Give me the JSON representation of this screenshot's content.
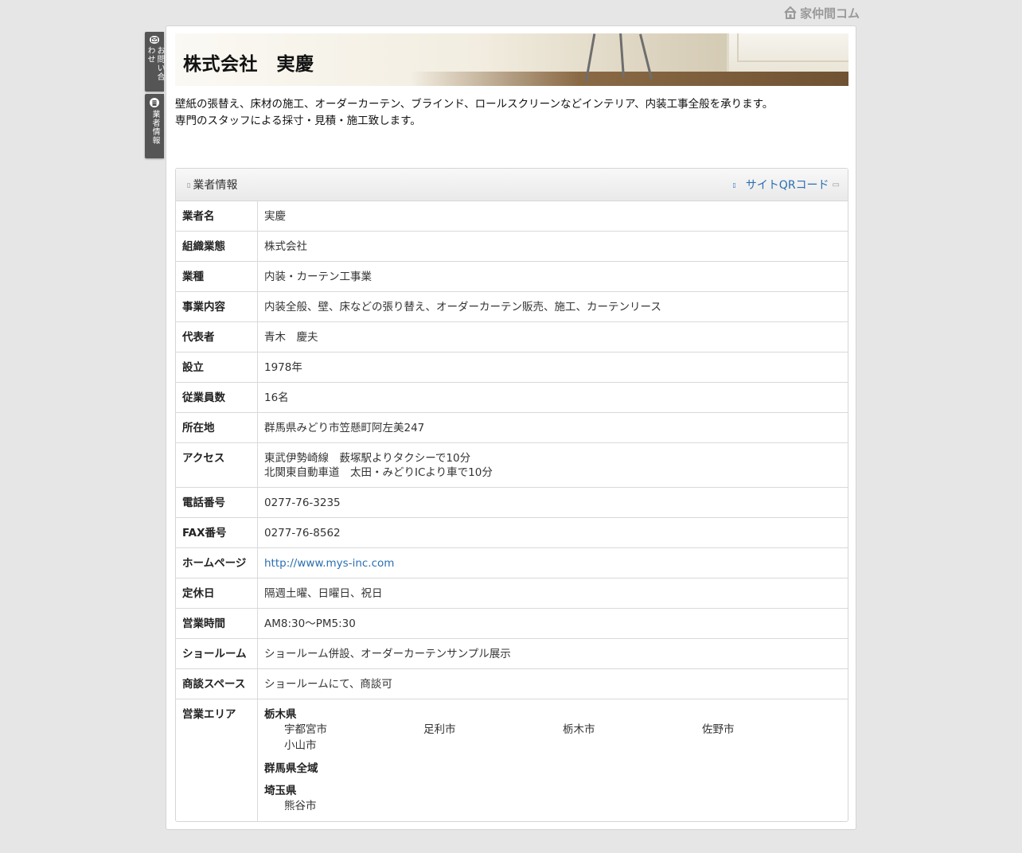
{
  "brand": {
    "name": "家仲間コム"
  },
  "side_tabs": {
    "contact": "お問い合わせ",
    "info": "業者情報"
  },
  "header": {
    "title": "株式会社　実慶"
  },
  "intro": {
    "line1": "壁紙の張替え、床材の施工、オーダーカーテン、ブラインド、ロールスクリーンなどインテリア、内装工事全般を承ります。",
    "line2": "専門のスタッフによる採寸・見積・施工致します。"
  },
  "panel": {
    "title": "業者情報",
    "qr_label": "サイトQRコード"
  },
  "rows": [
    {
      "label": "業者名",
      "value": "実慶"
    },
    {
      "label": "組織業態",
      "value": "株式会社"
    },
    {
      "label": "業種",
      "value": "内装・カーテン工事業"
    },
    {
      "label": "事業内容",
      "value": "内装全般、壁、床などの張り替え、オーダーカーテン販売、施工、カーテンリース"
    },
    {
      "label": "代表者",
      "value": "青木　慶夫"
    },
    {
      "label": "設立",
      "value": "1978年"
    },
    {
      "label": "従業員数",
      "value": "16名"
    },
    {
      "label": "所在地",
      "value": "群馬県みどり市笠懸町阿左美247"
    },
    {
      "label": "アクセス",
      "value": "東武伊勢崎線　薮塚駅よりタクシーで10分",
      "value2": "北関東自動車道　太田・みどりICより車で10分"
    },
    {
      "label": "電話番号",
      "value": "0277-76-3235"
    },
    {
      "label": "FAX番号",
      "value": "0277-76-8562"
    },
    {
      "label": "ホームページ",
      "value": "http://www.mys-inc.com"
    },
    {
      "label": "定休日",
      "value": "隔週土曜、日曜日、祝日"
    },
    {
      "label": "営業時間",
      "value": "AM8:30〜PM5:30"
    },
    {
      "label": "ショールーム",
      "value": "ショールーム併設、オーダーカーテンサンプル展示"
    },
    {
      "label": "商談スペース",
      "value": "ショールームにて、商談可"
    },
    {
      "label": "営業エリア"
    }
  ],
  "areas": [
    {
      "pref": "栃木県",
      "cities": [
        "宇都宮市",
        "足利市",
        "栃木市",
        "佐野市",
        "小山市"
      ]
    },
    {
      "pref": "群馬県全域",
      "cities": []
    },
    {
      "pref": "埼玉県",
      "cities": [
        "熊谷市"
      ]
    }
  ]
}
